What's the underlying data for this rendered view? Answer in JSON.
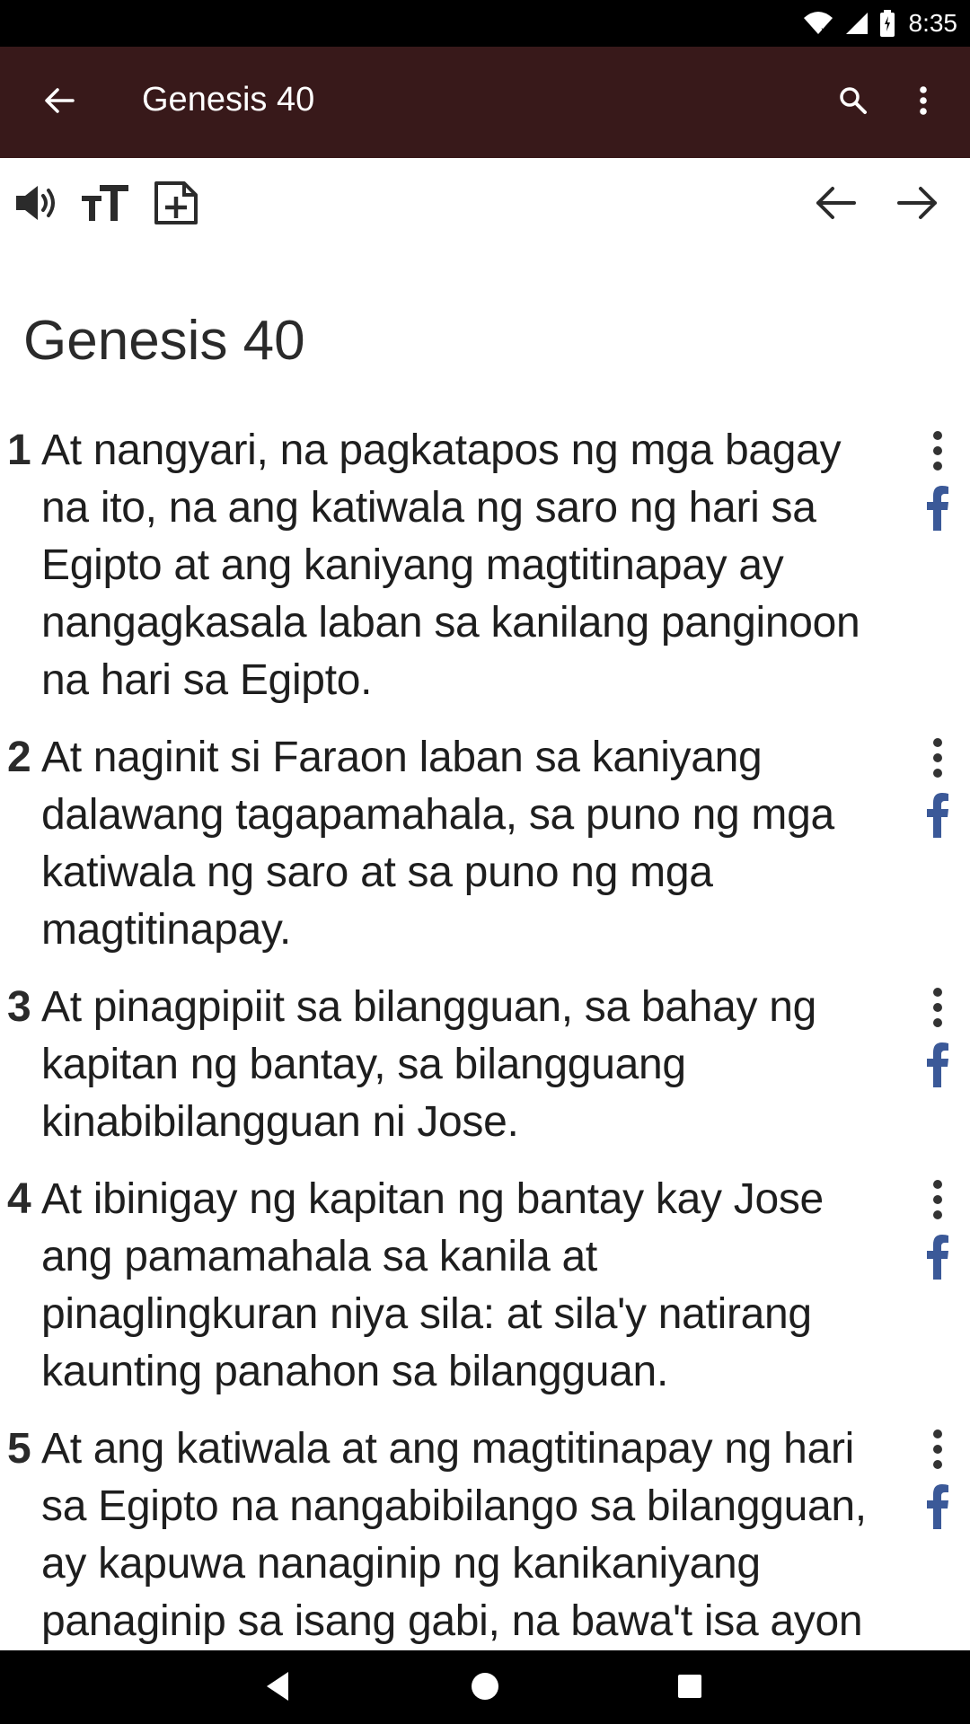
{
  "status_bar": {
    "time": "8:35",
    "icons": [
      "wifi-icon",
      "signal-icon",
      "battery-icon"
    ]
  },
  "app_bar": {
    "title": "Genesis 40",
    "back_icon": "arrow-left-icon",
    "search_icon": "search-icon",
    "more_icon": "more-vert-icon"
  },
  "toolbar": {
    "left_icons": [
      "speaker-icon",
      "text-size-icon",
      "add-note-icon"
    ],
    "right_icons": [
      "prev-chapter-icon",
      "next-chapter-icon"
    ]
  },
  "chapter": {
    "title": "Genesis 40"
  },
  "verses": [
    {
      "number": "1",
      "text": "At nangyari, na pagkatapos ng mga bagay na ito, na ang katiwala ng saro ng hari sa Egipto at ang kaniyang magtitinapay ay nangagkasala laban sa kanilang panginoon na hari sa Egipto."
    },
    {
      "number": "2",
      "text": "At naginit si Faraon laban sa kaniyang dalawang tagapamahala, sa puno ng mga katiwala ng saro at sa puno ng mga magtitinapay."
    },
    {
      "number": "3",
      "text": "At pinagpipiit sa bilangguan, sa bahay ng kapitan ng bantay, sa bilangguang kinabibilangguan ni Jose."
    },
    {
      "number": "4",
      "text": "At ibinigay ng kapitan ng bantay kay Jose ang pamamahala sa kanila at pinaglingkuran niya sila: at sila'y natirang kaunting panahon sa bilangguan."
    },
    {
      "number": "5",
      "text": "At ang katiwala at ang magtitinapay ng hari sa Egipto na nangabibilango sa bilangguan, ay kapuwa nanaginip ng kanikaniyang panaginip sa isang gabi, na bawa't isa ayon"
    }
  ],
  "nav_bar": {
    "icons": [
      "nav-back-icon",
      "nav-home-icon",
      "nav-recents-icon"
    ]
  },
  "colors": {
    "app_bar_bg": "#38191a",
    "facebook_blue": "#3b5998",
    "text": "#1e1e1e"
  }
}
